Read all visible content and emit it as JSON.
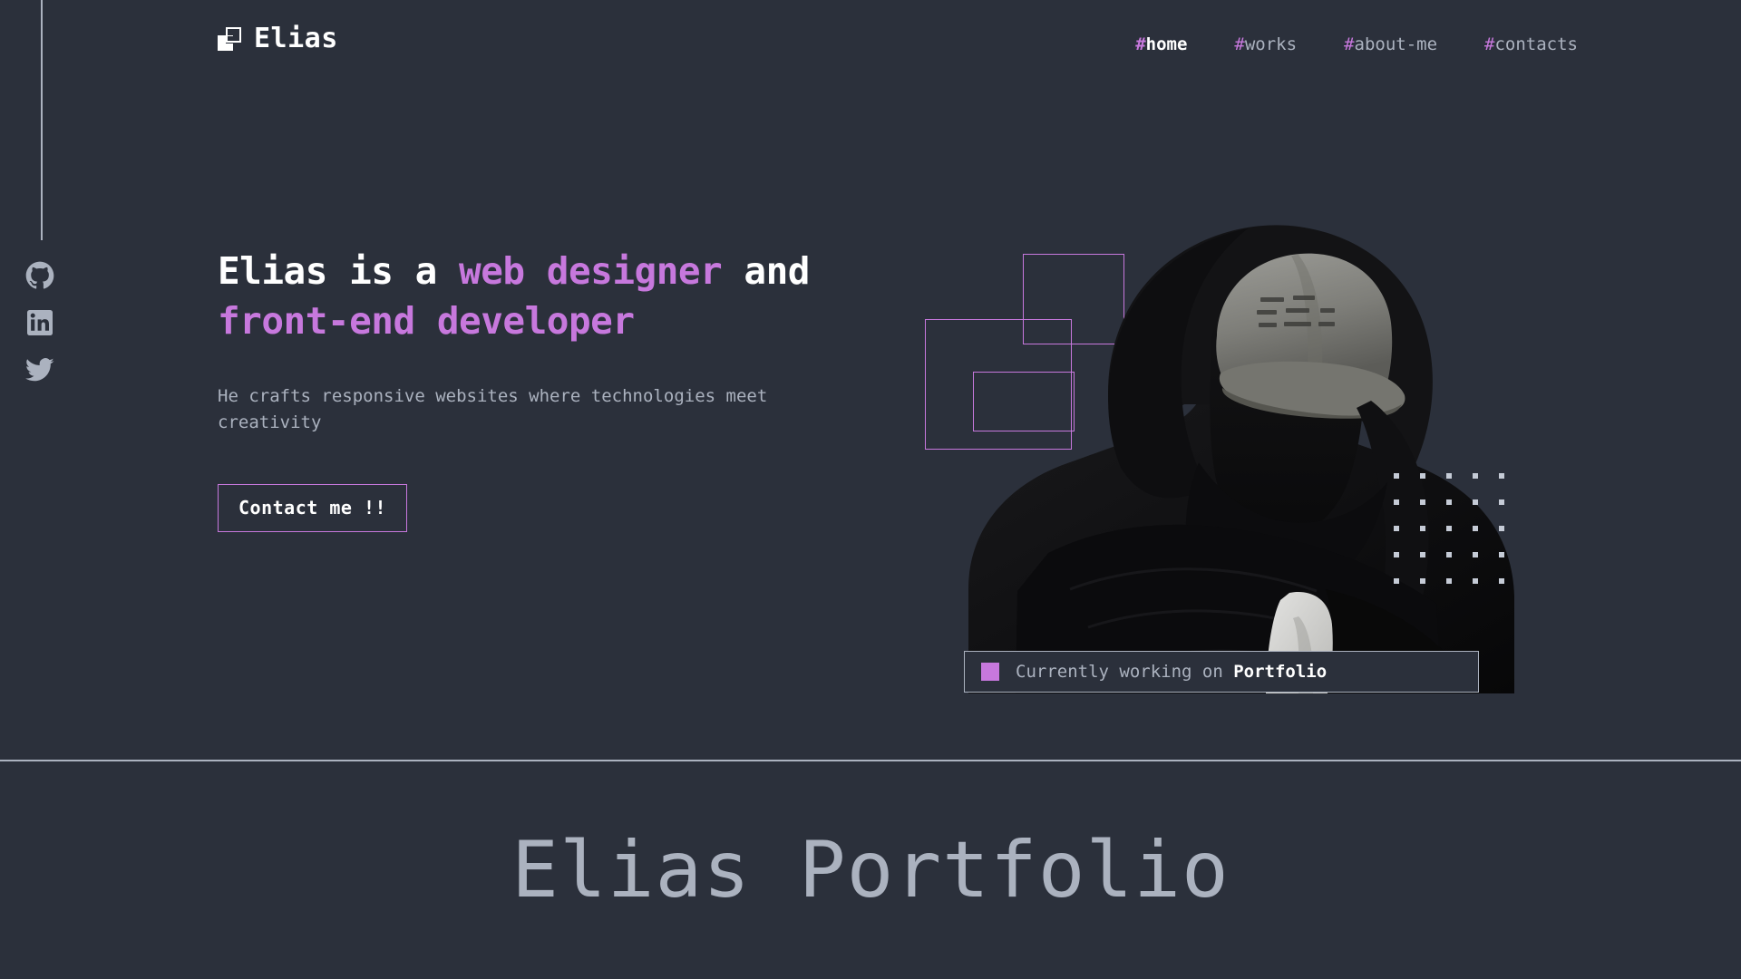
{
  "theme": {
    "background": "#2b303b",
    "accent_purple": "#c778dd",
    "text_muted": "#abb2bf",
    "text_bright": "#ffffff"
  },
  "header": {
    "brand_name": "Elias",
    "logo_icon": "overlapping-squares-icon",
    "nav": [
      {
        "hash": "#",
        "label": "home",
        "active": true,
        "icon": "nav-link"
      },
      {
        "hash": "#",
        "label": "works",
        "active": false,
        "icon": "nav-link"
      },
      {
        "hash": "#",
        "label": "about-me",
        "active": false,
        "icon": "nav-link"
      },
      {
        "hash": "#",
        "label": "contacts",
        "active": false,
        "icon": "nav-link"
      }
    ]
  },
  "left_rail": {
    "socials": [
      {
        "name": "github",
        "icon": "github-icon"
      },
      {
        "name": "linkedin",
        "icon": "linkedin-icon"
      },
      {
        "name": "twitter",
        "icon": "twitter-icon"
      }
    ]
  },
  "hero": {
    "headline": {
      "part1": "Elias is a ",
      "accent1": "web designer",
      "part2": " and",
      "accent2": "front-end developer"
    },
    "subcopy": "He crafts responsive websites where technologies meet creativity",
    "cta_label": "Contact me !!",
    "status": {
      "prefix": "Currently working on ",
      "project": "Portfolio",
      "swatch_color": "#c778dd"
    },
    "photo_alt": "person-in-dark-hoodie-and-cap",
    "decor": {
      "rectangles": 3,
      "dot_grid_rows": 5,
      "dot_grid_cols": 5
    }
  },
  "portfolio_section": {
    "title": "Elias Portfolio"
  }
}
